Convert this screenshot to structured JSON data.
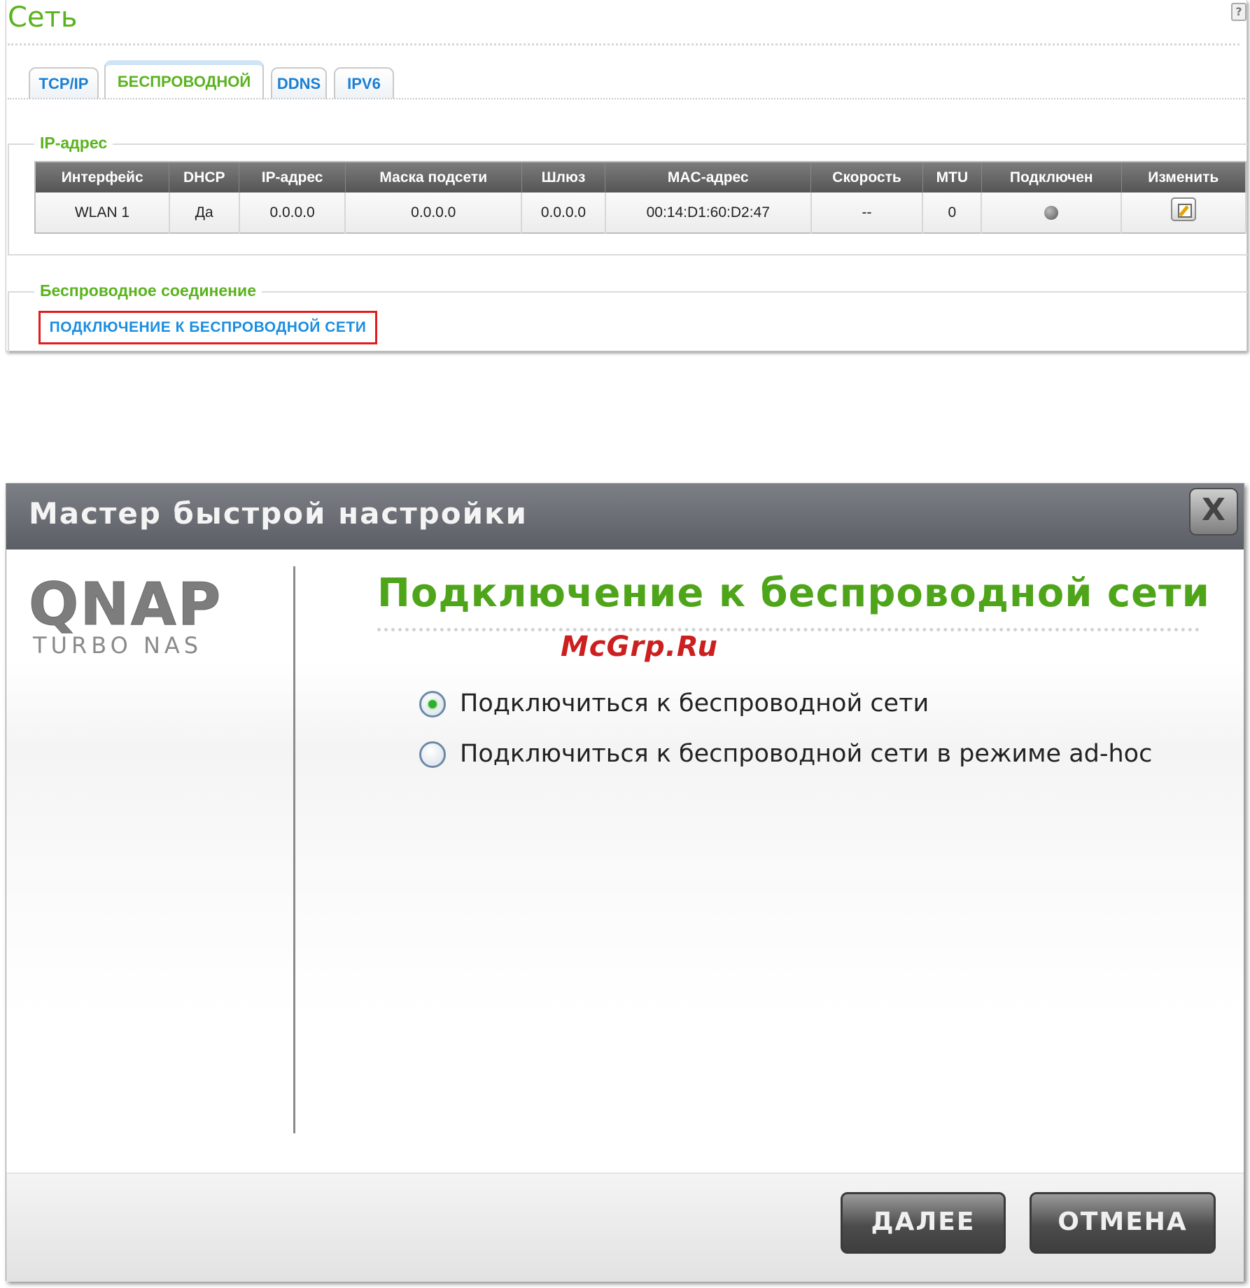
{
  "network": {
    "title": "Сеть",
    "help_label": "?",
    "tabs": [
      {
        "label": "TCP/IP",
        "active": false
      },
      {
        "label": "БЕСПРОВОДНОЙ",
        "active": true
      },
      {
        "label": "DDNS",
        "active": false
      },
      {
        "label": "IPV6",
        "active": false
      }
    ],
    "ip_section": {
      "legend": "IP-адрес",
      "columns": [
        "Интерфейс",
        "DHCP",
        "IP-адрес",
        "Маска подсети",
        "Шлюз",
        "MAC-адрес",
        "Скорость",
        "MTU",
        "Подключен",
        "Изменить"
      ],
      "rows": [
        {
          "interface": "WLAN 1",
          "dhcp": "Да",
          "ip": "0.0.0.0",
          "mask": "0.0.0.0",
          "gateway": "0.0.0.0",
          "mac": "00:14:D1:60:D2:47",
          "speed": "--",
          "mtu": "0",
          "connected_icon": "status-dot-gray",
          "edit_icon": "edit-icon"
        }
      ]
    },
    "wireless_section": {
      "legend": "Беспроводное соединение",
      "link_label": "ПОДКЛЮЧЕНИЕ К БЕСПРОВОДНОЙ СЕТИ",
      "highlight_color": "#e21b1b"
    }
  },
  "wizard": {
    "title": "Мастер быстрой настройки",
    "close_label": "X",
    "logo_text": "QNAP",
    "logo_subtext": "TURBO NAS",
    "heading": "Подключение к беспроводной сети",
    "watermark": "McGrp.Ru",
    "options": [
      {
        "label": "Подключиться к беспроводной сети",
        "checked": true
      },
      {
        "label": "Подключиться к беспроводной сети в режиме ad-hoc",
        "checked": false
      }
    ],
    "buttons": {
      "next": "ДАЛЕЕ",
      "cancel": "ОТМЕНА"
    }
  },
  "colors": {
    "accent_green": "#5ab31e",
    "link_blue": "#1a8ee0",
    "header_gray": "#5c5e66"
  }
}
